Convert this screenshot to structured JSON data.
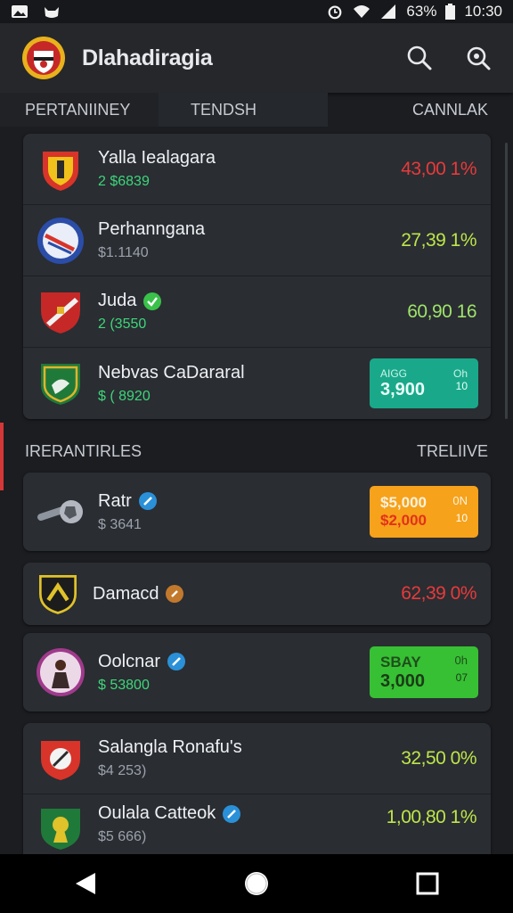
{
  "status_bar": {
    "battery": "63%",
    "time": "10:30"
  },
  "app": {
    "title": "Dlahadiragia"
  },
  "tabs": [
    {
      "label": "PERTANIINEY"
    },
    {
      "label": "TENDSH"
    },
    {
      "label": "CANNLAK"
    }
  ],
  "top_list": [
    {
      "name": "Yalla Iealagara",
      "sub": "2 $6839",
      "value": "43,00 1%"
    },
    {
      "name": "Perhanngana",
      "sub": "$1.1140",
      "value": "27,39 1%"
    },
    {
      "name": "Juda",
      "sub": "2 (3550",
      "value": "60,90 16"
    },
    {
      "name": "Nebvas CaDararal",
      "sub": "$ ( 8920",
      "pill_top_left": "AIGG",
      "pill_top_right": "Oh",
      "pill_value": "3,900",
      "pill_small": "10"
    }
  ],
  "section": {
    "left": "IRERANTIRLES",
    "right": "TRELIIVE"
  },
  "cards": [
    {
      "name": "Ratr",
      "sub": "$ 3641",
      "pill_top_left": "$5,000",
      "pill_top_right": "0N",
      "pill_value": "$2,000",
      "pill_small": "10"
    },
    {
      "name": "Damacd",
      "value": "62,39 0%"
    },
    {
      "name": "Oolcnar",
      "sub": "$ 53800",
      "pill_top_left": "SBAY",
      "pill_top_right": "0h",
      "pill_value": "3,000",
      "pill_small": "07"
    }
  ],
  "bottom_list": [
    {
      "name": "Salangla Ronafu's",
      "sub": "$4 253)",
      "value": "32,50 0%"
    },
    {
      "name": "Oulala Catteok",
      "sub": "$5 666)",
      "value": "1,00,80 1%"
    }
  ],
  "colors": {
    "red": "#e83a3a",
    "lime": "#bde54a",
    "teal": "#19a98a",
    "orange": "#f6a21a",
    "green": "#37c034"
  }
}
